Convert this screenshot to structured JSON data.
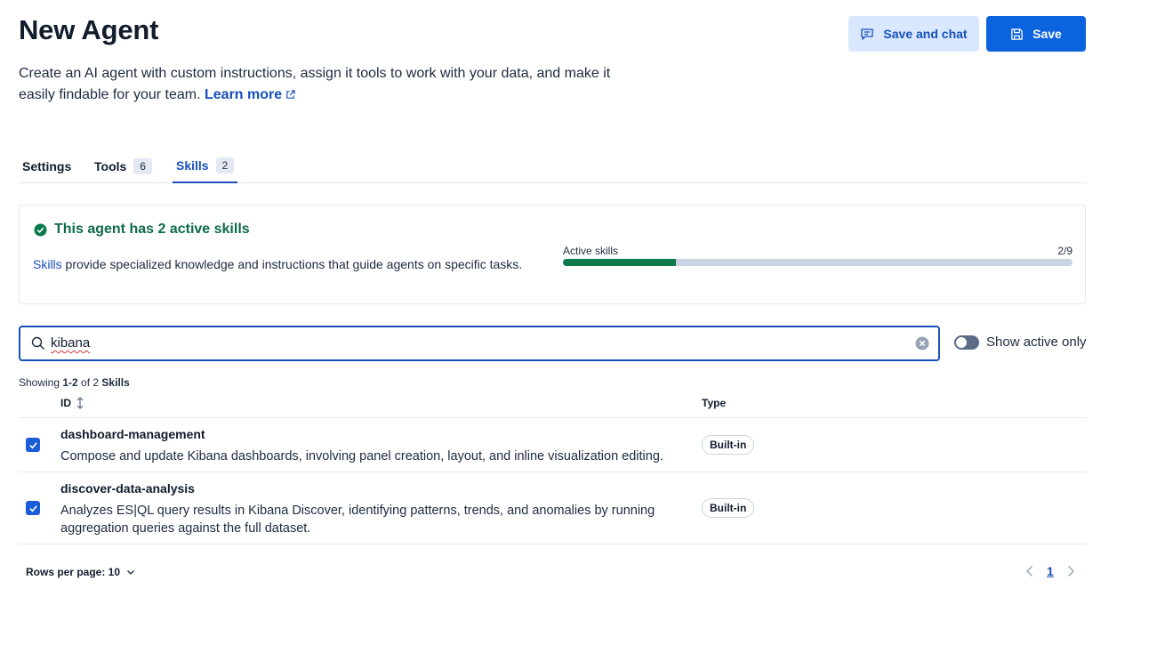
{
  "header": {
    "title": "New Agent",
    "description": "Create an AI agent with custom instructions, assign it tools to work with your data, and make it easily findable for your team.",
    "learn_more": "Learn more",
    "save_and_chat": "Save and chat",
    "save": "Save"
  },
  "tabs": [
    {
      "label": "Settings",
      "count": ""
    },
    {
      "label": "Tools",
      "count": "6"
    },
    {
      "label": "Skills",
      "count": "2"
    }
  ],
  "summary": {
    "heading": "This agent has 2 active skills",
    "skills_link": "Skills",
    "text": " provide specialized knowledge and instructions that guide agents on specific tasks.",
    "meter_label": "Active skills",
    "meter_value": "2/9",
    "active_count": 2,
    "total_count": 9
  },
  "search": {
    "value": "kibana"
  },
  "toggle": {
    "label": "Show active only",
    "on": false
  },
  "results": {
    "showing_prefix": "Showing ",
    "range": "1-2",
    "of": " of ",
    "total": "2",
    "noun": " Skills"
  },
  "table": {
    "col_id": "ID",
    "col_type": "Type",
    "rows": [
      {
        "id": "dashboard-management",
        "description": "Compose and update Kibana dashboards, involving panel creation, layout, and inline visualization editing.",
        "type": "Built-in",
        "checked": true
      },
      {
        "id": "discover-data-analysis",
        "description": "Analyzes ES|QL query results in Kibana Discover, identifying patterns, trends, and anomalies by running aggregation queries against the full dataset.",
        "type": "Built-in",
        "checked": true
      }
    ]
  },
  "footer": {
    "rows_per_page": "Rows per page: 10",
    "current_page": "1"
  },
  "colors": {
    "primary": "#0b64dd",
    "link": "#1750ba",
    "success": "#0d6b46",
    "meter_fill": "#0d7a4c"
  }
}
